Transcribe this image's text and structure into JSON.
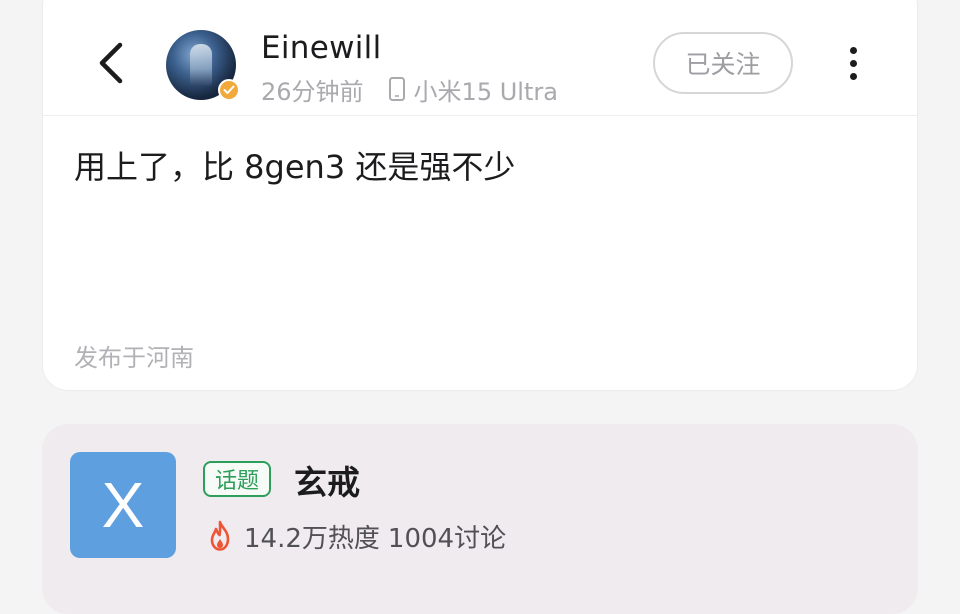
{
  "header": {
    "username": "Einewill",
    "time_ago": "26分钟前",
    "device": "小米15 Ultra",
    "follow_label": "已关注"
  },
  "post": {
    "text": "用上了，比 8gen3 还是强不少",
    "location": "发布于河南"
  },
  "topic": {
    "thumb_letter": "X",
    "tag_label": "话题",
    "title": "玄戒",
    "heat": "14.2万热度",
    "discussions": "1004讨论"
  },
  "colors": {
    "accent_green": "#2e9f5a",
    "badge_orange": "#f2a93b",
    "fire_red": "#ee5534",
    "thumb_blue": "#5e9fe0"
  },
  "icons": [
    "back-arrow-icon",
    "verified-badge-icon",
    "phone-icon",
    "more-vertical-icon",
    "fire-icon"
  ]
}
